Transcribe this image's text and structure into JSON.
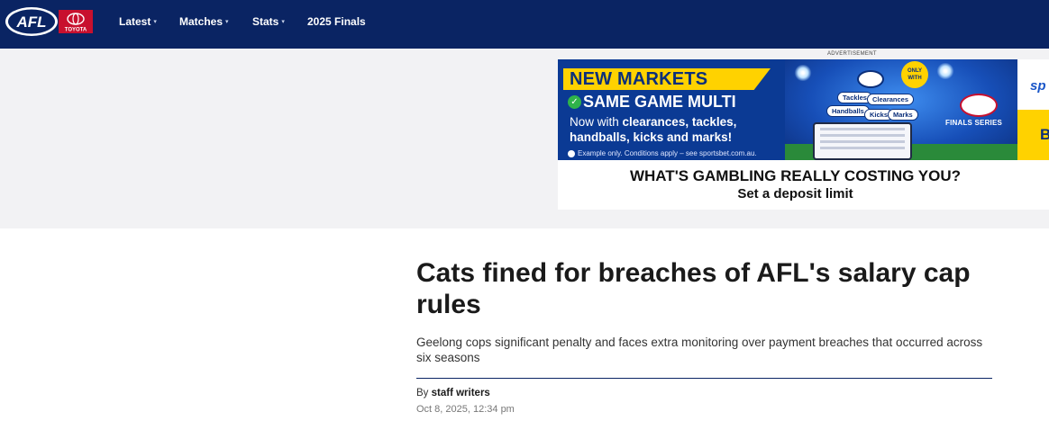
{
  "nav": {
    "logo_text": "AFL",
    "sponsor_text": "TOYOTA",
    "items": [
      {
        "label": "Latest",
        "has_caret": true
      },
      {
        "label": "Matches",
        "has_caret": true
      },
      {
        "label": "Stats",
        "has_caret": true
      },
      {
        "label": "2025 Finals",
        "has_caret": false
      }
    ],
    "caret_glyph": "▾"
  },
  "advertisement": {
    "label": "ADVERTISEMENT",
    "headline": "NEW MARKETS",
    "subhead": "SAME GAME MULTI",
    "copy_prefix": "Now with ",
    "copy_bold": "clearances, tackles, handballs, kicks and marks!",
    "disclaimer": "Example only. Conditions apply – see sportsbet.com.au.",
    "bubbles": [
      "Tackles",
      "Clearances",
      "Handballs",
      "Kicks",
      "Marks"
    ],
    "only_badge": "ONLY WITH",
    "finals": "FINALS SERIES",
    "brand_partial": "sp",
    "brand_partial2": "B",
    "gambling_line1": "WHAT'S GAMBLING REALLY COSTING YOU?",
    "gambling_line2": "Set a deposit limit"
  },
  "article": {
    "headline": "Cats fined for breaches of AFL's salary cap rules",
    "standfirst": "Geelong cops significant penalty and faces extra monitoring over payment breaches that occurred across six seasons",
    "byline_prefix": "By ",
    "author": "staff writers",
    "date": "Oct 8, 2025, 12:34 pm"
  },
  "colors": {
    "nav_bg": "#0a2463",
    "ad_band_bg": "#f2f2f4",
    "afl_red": "#c8102e",
    "ad_yellow": "#ffd200"
  }
}
